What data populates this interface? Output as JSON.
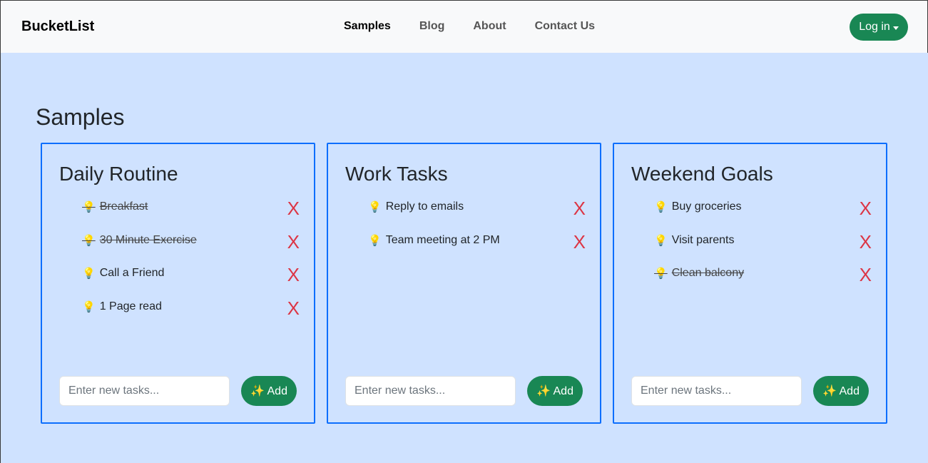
{
  "navbar": {
    "brand": "BucketList",
    "links": [
      "Samples",
      "Blog",
      "About",
      "Contact Us"
    ],
    "login_label": "Log in"
  },
  "page_title": "Samples",
  "cards": [
    {
      "title": "Daily Routine",
      "tasks": [
        {
          "text": "Breakfast",
          "done": true
        },
        {
          "text": "30 Minute Exercise",
          "done": true
        },
        {
          "text": "Call a Friend",
          "done": false
        },
        {
          "text": "1 Page read",
          "done": false
        }
      ],
      "input_placeholder": "Enter new tasks...",
      "add_label": "✨ Add"
    },
    {
      "title": "Work Tasks",
      "tasks": [
        {
          "text": "Reply to emails",
          "done": false
        },
        {
          "text": "Team meeting at 2 PM",
          "done": false
        }
      ],
      "input_placeholder": "Enter new tasks...",
      "add_label": "✨ Add"
    },
    {
      "title": "Weekend Goals",
      "tasks": [
        {
          "text": "Buy groceries",
          "done": false
        },
        {
          "text": "Visit parents",
          "done": false
        },
        {
          "text": "Clean balcony",
          "done": true
        }
      ],
      "input_placeholder": "Enter new tasks...",
      "add_label": "✨ Add"
    }
  ],
  "task_icon": "💡",
  "delete_label": "X",
  "colors": {
    "page_bg": "#cfe2ff",
    "card_border": "#0d6efd",
    "button_green": "#198754",
    "delete_red": "#dc3545"
  }
}
